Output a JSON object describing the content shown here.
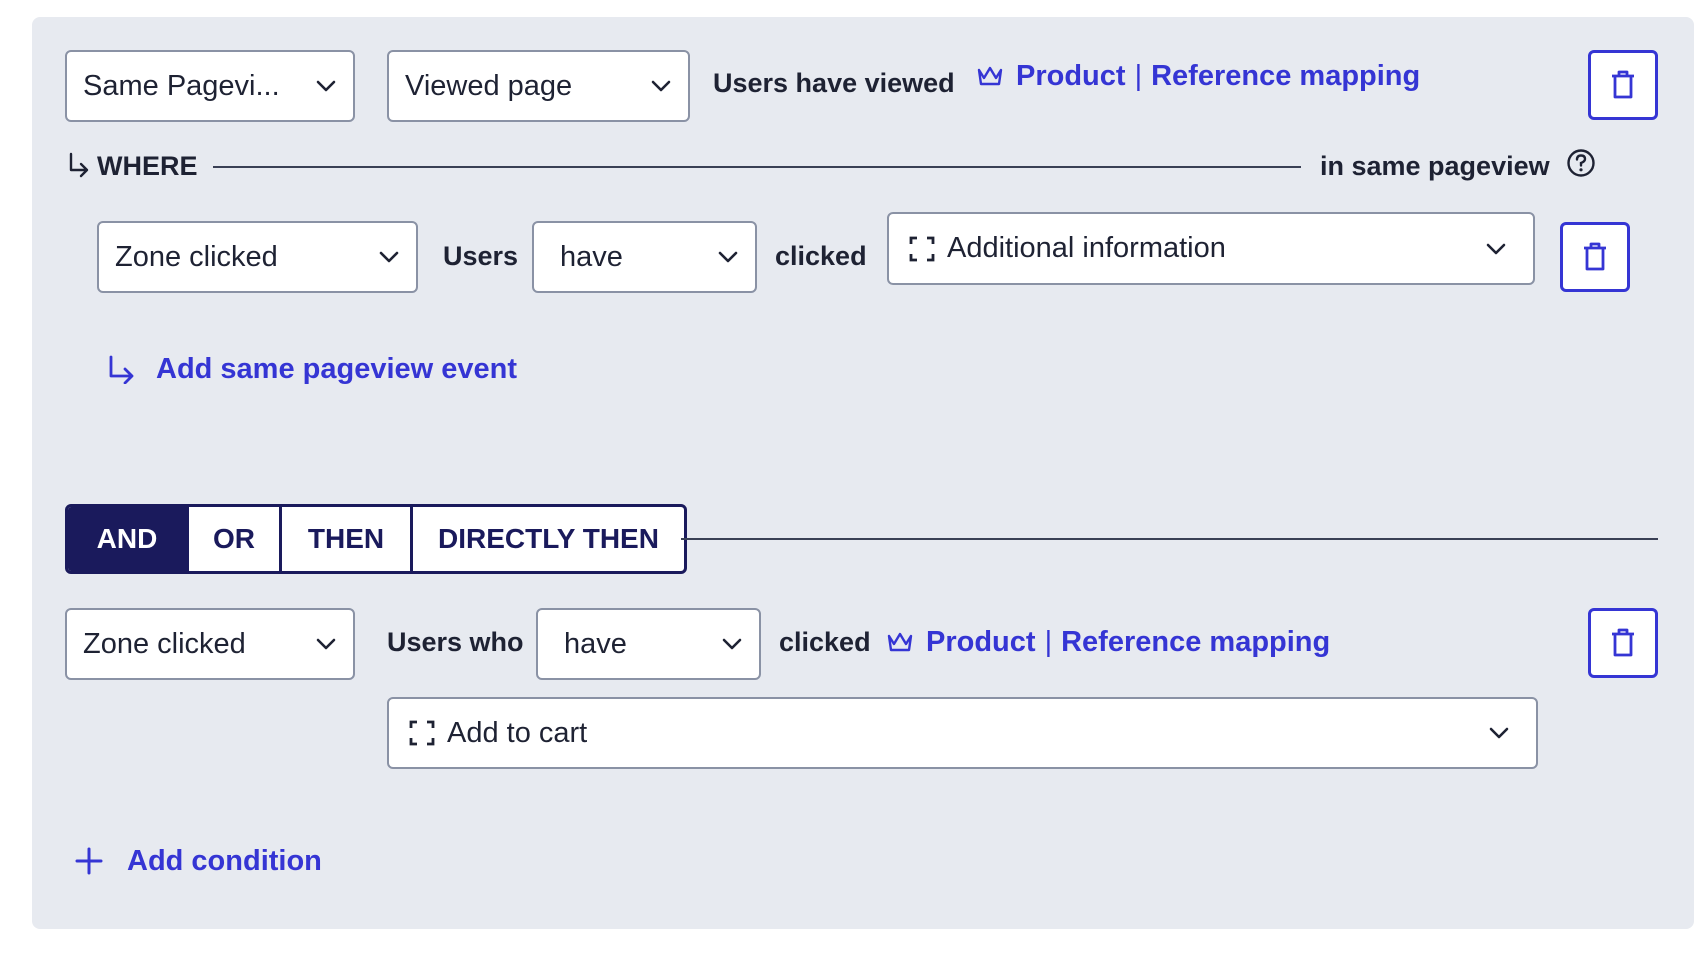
{
  "row1": {
    "pageview_select": "Same Pagevi...",
    "event_select": "Viewed page",
    "label": "Users have viewed",
    "link_part1": "Product",
    "link_sep": "|",
    "link_part2": "Reference mapping"
  },
  "where": {
    "label": "WHERE",
    "scope": "in same pageview"
  },
  "sub_row": {
    "event_select": "Zone clicked",
    "users_label": "Users",
    "have_select": "have",
    "clicked_label": "clicked",
    "zone_select": "Additional information"
  },
  "add_pageview_event": "Add same pageview event",
  "operators": [
    {
      "label": "AND",
      "active": true
    },
    {
      "label": "OR",
      "active": false
    },
    {
      "label": "THEN",
      "active": false
    },
    {
      "label": "DIRECTLY THEN",
      "active": false
    }
  ],
  "row2": {
    "event_select": "Zone clicked",
    "users_label": "Users who",
    "have_select": "have",
    "clicked_label": "clicked",
    "link_part1": "Product",
    "link_sep": "|",
    "link_part2": "Reference mapping",
    "zone_select": "Add to cart"
  },
  "add_condition": "Add condition",
  "colors": {
    "accent": "#3535d4",
    "dark": "#1a1a5c",
    "panel_bg": "#e7eaf0"
  },
  "icons": [
    "chevron-down-icon",
    "crown-icon",
    "trash-icon",
    "return-arrow-icon",
    "help-icon",
    "zone-brackets-icon",
    "plus-icon"
  ]
}
